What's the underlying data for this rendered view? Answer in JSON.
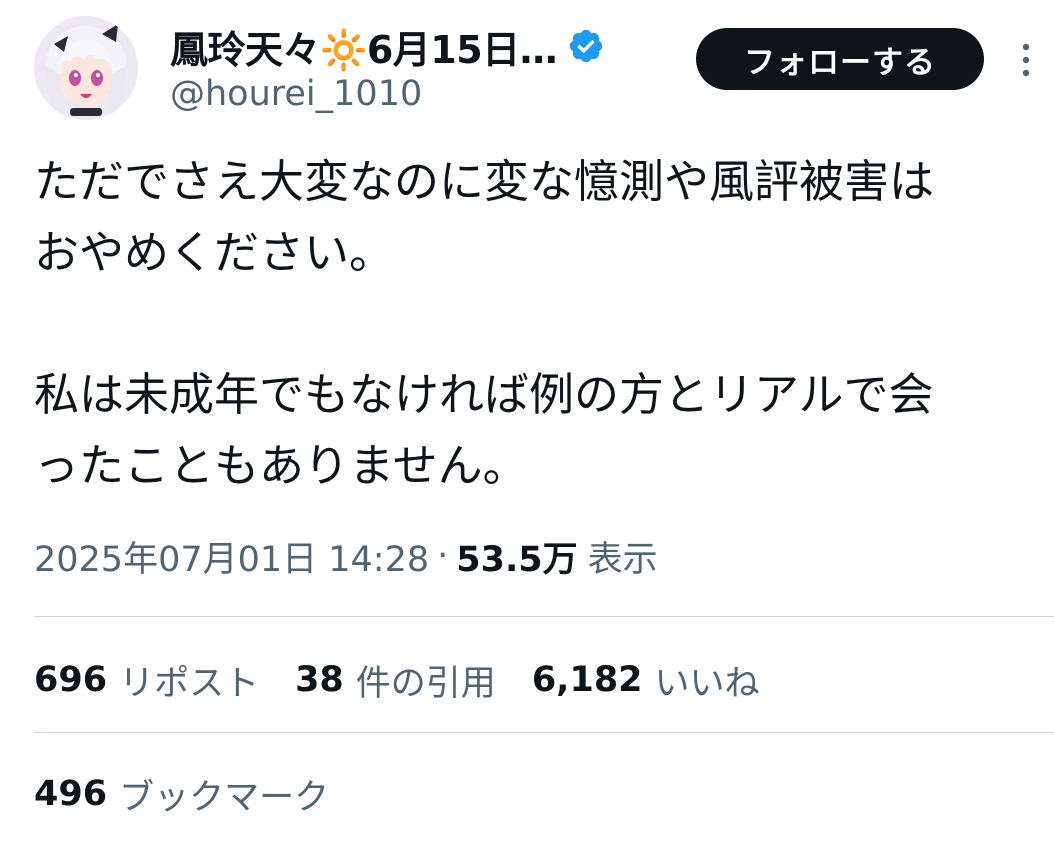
{
  "header": {
    "display_name": "鳳玲天々🔆6月15日…",
    "handle": "@hourei_1010",
    "follow_label": "フォローする"
  },
  "icons": {
    "avatar": "anime-avatar",
    "verified": "verified-badge-icon",
    "more": "more-vertical-icon"
  },
  "colors": {
    "verified": "#1d9bf0",
    "follow_bg": "#0f1419",
    "secondary_text": "#536471",
    "divider": "#cfd9de"
  },
  "tweet": {
    "line1": "ただでさえ大変なのに変な憶測や風評被害は",
    "line2": "おやめください。",
    "line3": "私は未成年でもなければ例の方とリアルで会",
    "line4": "ったこともありません。"
  },
  "meta": {
    "timestamp": "2025年07月01日 14:28",
    "separator": "·",
    "views_count": "53.5万",
    "views_label": "表示"
  },
  "stats": {
    "reposts_count": "696",
    "reposts_label": "リポスト",
    "quotes_count": "38",
    "quotes_label": "件の引用",
    "likes_count": "6,182",
    "likes_label": "いいね",
    "bookmarks_count": "496",
    "bookmarks_label": "ブックマーク"
  }
}
